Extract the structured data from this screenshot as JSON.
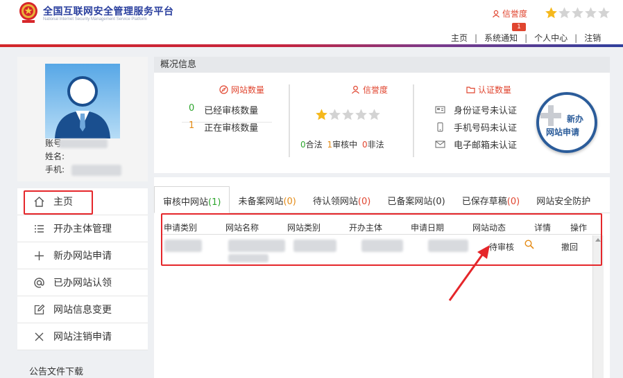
{
  "header": {
    "title_cn": "全国互联网安全管理服务平台",
    "title_en": "National Internet Security Management Service Platform",
    "credit_label": "信誉度",
    "notification_badge": "1",
    "nav": [
      "主页",
      "系统通知",
      "个人中心",
      "注销"
    ],
    "star_rating": 1,
    "star_total": 5
  },
  "profile": {
    "account_label": "账号:",
    "name_label": "姓名:",
    "phone_label": "手机:"
  },
  "menu": {
    "items": [
      {
        "label": "主页",
        "icon": "home-icon"
      },
      {
        "label": "开办主体管理",
        "icon": "list-icon"
      },
      {
        "label": "新办网站申请",
        "icon": "plus-icon"
      },
      {
        "label": "已办网站认领",
        "icon": "at-icon"
      },
      {
        "label": "网站信息变更",
        "icon": "edit-icon"
      },
      {
        "label": "网站注销申请",
        "icon": "close-icon"
      }
    ],
    "notice": "公告文件下载"
  },
  "overview": {
    "header": "概况信息",
    "site_count": {
      "title": "网站数量",
      "rows": [
        {
          "num": "0",
          "label": "已经审核数量"
        },
        {
          "num": "1",
          "label": "正在审核数量"
        }
      ]
    },
    "credit": {
      "title": "信誉度",
      "legal_num": "0",
      "legal_label": "合法",
      "review_num": "1",
      "review_label": "审核中",
      "illegal_num": "0",
      "illegal_label": "非法"
    },
    "cert": {
      "title": "认证数量",
      "rows": [
        "身份证号未认证",
        "手机号码未认证",
        "电子邮箱未认证"
      ]
    },
    "new_button": {
      "line1": "新办",
      "line2": "网站申请"
    }
  },
  "tabs": [
    {
      "label": "审核中网站",
      "count": "(1)"
    },
    {
      "label": "未备案网站",
      "count": "(0)"
    },
    {
      "label": "待认领网站",
      "count": "(0)"
    },
    {
      "label": "已备案网站",
      "count": "(0)"
    },
    {
      "label": "已保存草稿",
      "count": "(0)"
    },
    {
      "label": "网站安全防护",
      "count": ""
    }
  ],
  "table": {
    "columns": [
      "申请类别",
      "网站名称",
      "网站类别",
      "开办主体",
      "申请日期",
      "网站动态",
      "详情",
      "操作"
    ],
    "row": {
      "status": "待审核",
      "action": "撤回"
    }
  },
  "colors": {
    "brand_red": "#e0452f",
    "brand_blue": "#2a3f9e",
    "star_gold": "#f5b81c"
  }
}
